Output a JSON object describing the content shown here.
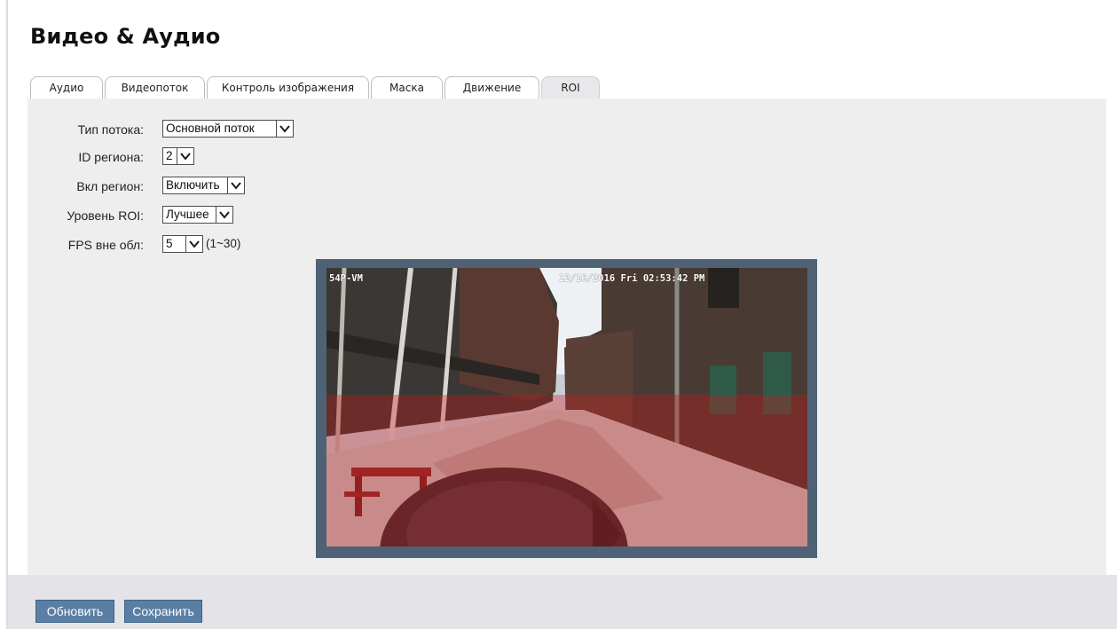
{
  "page": {
    "title": "Видео & Аудио"
  },
  "tabs": [
    {
      "label": "Аудио",
      "active": false
    },
    {
      "label": "Видеопоток",
      "active": false
    },
    {
      "label": "Контроль изображения",
      "active": false
    },
    {
      "label": "Маска",
      "active": false
    },
    {
      "label": "Движение",
      "active": false
    },
    {
      "label": "ROI",
      "active": true
    }
  ],
  "form": {
    "stream_type": {
      "label": "Тип потока:",
      "value": "Основной поток"
    },
    "region_id": {
      "label": "ID региона:",
      "value": "2"
    },
    "region_enable": {
      "label": "Вкл регион:",
      "value": "Включить"
    },
    "roi_level": {
      "label": "Уровень ROI:",
      "value": "Лучшее"
    },
    "fps_outside": {
      "label": "FPS вне обл:",
      "value": "5",
      "hint": "(1~30)"
    }
  },
  "video": {
    "osd_name": "54P-VM",
    "osd_timestamp": "12/16/2016 Fri 02:53:42 PM",
    "roi_overlay_color": "#cd1919"
  },
  "buttons": {
    "refresh": "Обновить",
    "save": "Сохранить"
  },
  "colors": {
    "button_bg": "#5b7fa4",
    "panel_bg": "#eeeeef",
    "frame_border": "#4f6275"
  }
}
